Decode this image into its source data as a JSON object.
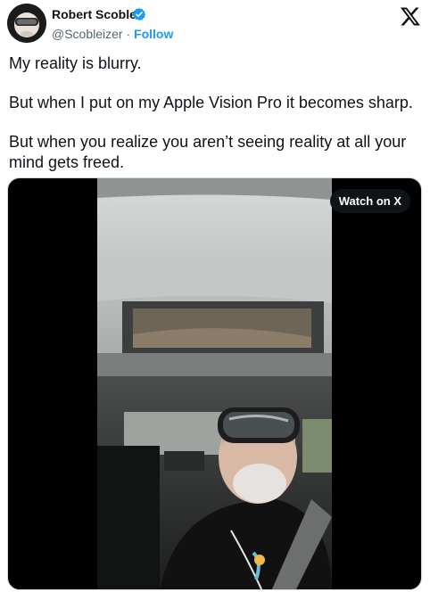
{
  "author": {
    "name": "Robert Scoble",
    "handle": "@Scobleizer",
    "separator": " · ",
    "follow_label": "Follow"
  },
  "tweet": {
    "paragraphs": [
      "My reality is blurry.",
      "But when I put on my Apple Vision Pro it becomes sharp.",
      "But when you realize you aren’t seeing reality at all your mind gets freed."
    ]
  },
  "media": {
    "watch_label": "Watch on X"
  },
  "icons": {
    "verified": "verified-badge-icon",
    "platform": "x-logo-icon"
  },
  "colors": {
    "accent": "#1d9bf0",
    "text": "#0f1419",
    "muted": "#536471"
  }
}
